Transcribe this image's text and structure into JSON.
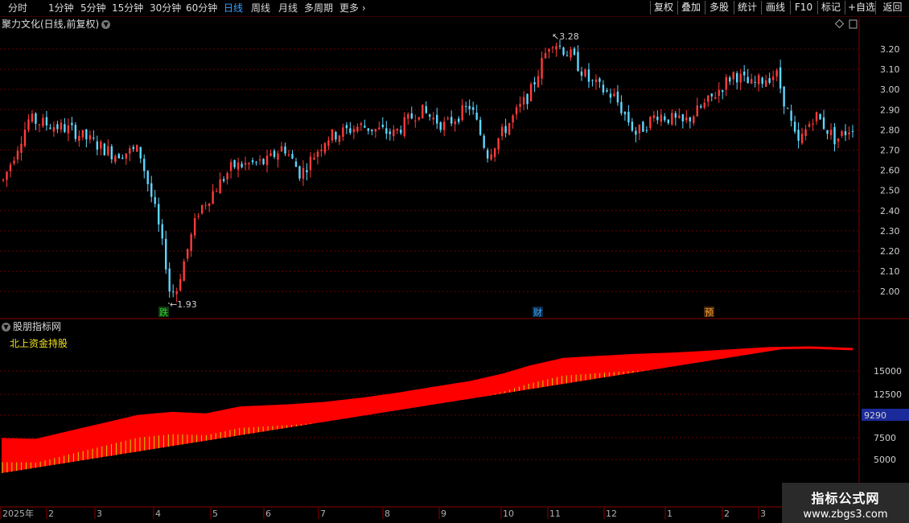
{
  "toolbar": {
    "timeframes": [
      "分时",
      "1分钟",
      "5分钟",
      "15分钟",
      "30分钟",
      "60分钟",
      "日线",
      "周线",
      "月线",
      "多周期",
      "更多"
    ],
    "active_timeframe": "日线",
    "right_buttons": [
      "复权",
      "叠加",
      "多股",
      "统计",
      "画线",
      "F10",
      "标记",
      "+自选",
      "返回"
    ]
  },
  "main_panel": {
    "title": "聚力文化(日线,前复权)",
    "price_axis": [
      "3.20",
      "3.10",
      "3.00",
      "2.90",
      "2.80",
      "2.70",
      "2.60",
      "2.50",
      "2.40",
      "2.30",
      "2.20",
      "2.10",
      "2.00"
    ],
    "high_label": "3.28",
    "low_label": "1.93",
    "markers": [
      {
        "text": "跌",
        "color": "#2fd02f",
        "bg": "#123a12"
      },
      {
        "text": "财",
        "color": "#40a8ff",
        "bg": "#0d2a44"
      },
      {
        "text": "预",
        "color": "#ffa030",
        "bg": "#442a0d"
      }
    ]
  },
  "indicator_panel": {
    "title": "股朋指标网",
    "name": "北上资金持股",
    "axis_labels": [
      "15000",
      "12500",
      "7500",
      "5000"
    ],
    "current_value": "9290"
  },
  "date_axis": [
    "2025年",
    "2",
    "3",
    "4",
    "5",
    "6",
    "7",
    "8",
    "9",
    "10",
    "11",
    "12",
    "1",
    "2",
    "3"
  ],
  "watermark": {
    "line1": "指标公式网",
    "line2": "www.zbgs3.com"
  },
  "colors": {
    "up": "#ff3b3b",
    "down": "#5fd7ff",
    "bar_fill": "#ff0000",
    "bar_tick": "#c8d800",
    "grid": "#6a0000",
    "active_tab": "#3aa0ff",
    "highlight_box": "#1a2a9a"
  },
  "chart_data": {
    "type": "candlestick",
    "price_ylim": [
      1.93,
      3.28
    ],
    "indicator_ylim": [
      0,
      19000
    ],
    "price_path": [
      [
        0,
        2.55
      ],
      [
        0.03,
        2.85
      ],
      [
        0.08,
        2.8
      ],
      [
        0.13,
        2.68
      ],
      [
        0.16,
        2.7
      ],
      [
        0.18,
        2.38
      ],
      [
        0.2,
        1.96
      ],
      [
        0.23,
        2.4
      ],
      [
        0.27,
        2.62
      ],
      [
        0.31,
        2.64
      ],
      [
        0.33,
        2.72
      ],
      [
        0.35,
        2.58
      ],
      [
        0.38,
        2.76
      ],
      [
        0.42,
        2.82
      ],
      [
        0.46,
        2.78
      ],
      [
        0.49,
        2.9
      ],
      [
        0.52,
        2.82
      ],
      [
        0.55,
        2.92
      ],
      [
        0.57,
        2.68
      ],
      [
        0.59,
        2.8
      ],
      [
        0.62,
        2.98
      ],
      [
        0.645,
        3.25
      ],
      [
        0.67,
        3.16
      ],
      [
        0.69,
        3.04
      ],
      [
        0.72,
        2.96
      ],
      [
        0.745,
        2.78
      ],
      [
        0.77,
        2.88
      ],
      [
        0.8,
        2.83
      ],
      [
        0.83,
        2.94
      ],
      [
        0.86,
        3.08
      ],
      [
        0.88,
        3.02
      ],
      [
        0.91,
        3.08
      ],
      [
        0.935,
        2.72
      ],
      [
        0.955,
        2.88
      ],
      [
        0.98,
        2.75
      ],
      [
        1.0,
        2.82
      ]
    ],
    "indicator_path": [
      [
        0,
        5800
      ],
      [
        0.04,
        5700
      ],
      [
        0.09,
        7000
      ],
      [
        0.16,
        8800
      ],
      [
        0.2,
        9200
      ],
      [
        0.24,
        9000
      ],
      [
        0.28,
        9900
      ],
      [
        0.34,
        10200
      ],
      [
        0.38,
        10500
      ],
      [
        0.42,
        11000
      ],
      [
        0.46,
        11600
      ],
      [
        0.51,
        12500
      ],
      [
        0.55,
        13200
      ],
      [
        0.59,
        14200
      ],
      [
        0.62,
        15200
      ],
      [
        0.66,
        16200
      ],
      [
        0.69,
        16400
      ],
      [
        0.74,
        16700
      ],
      [
        0.79,
        16900
      ],
      [
        0.84,
        17200
      ],
      [
        0.9,
        17600
      ],
      [
        0.95,
        17700
      ],
      [
        1.0,
        17500
      ]
    ]
  }
}
